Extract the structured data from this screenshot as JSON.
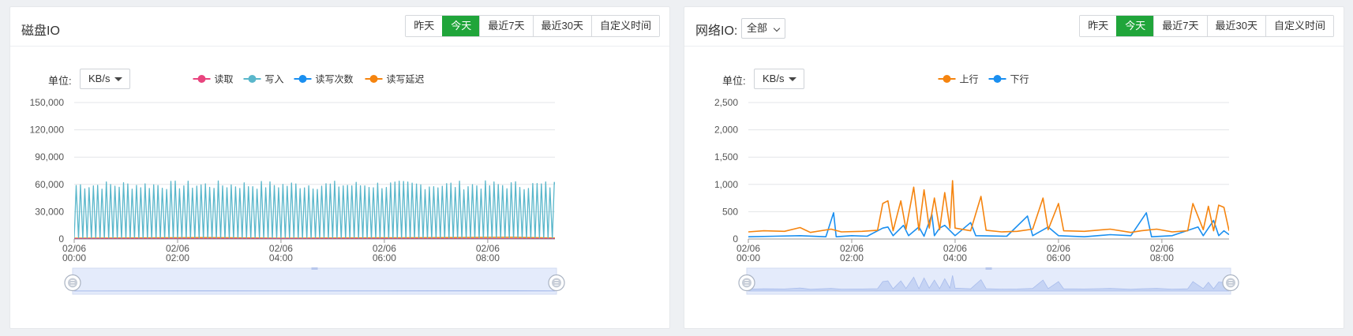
{
  "disk": {
    "title": "磁盘IO",
    "tabs": [
      {
        "label": "昨天",
        "active": false
      },
      {
        "label": "今天",
        "active": true
      },
      {
        "label": "最近7天",
        "active": false
      },
      {
        "label": "最近30天",
        "active": false
      },
      {
        "label": "自定义时间",
        "active": false
      }
    ],
    "unit_label": "单位:",
    "unit_value": "KB/s"
  },
  "net": {
    "title": "网络IO:",
    "filter_value": "全部",
    "tabs": [
      {
        "label": "昨天",
        "active": false
      },
      {
        "label": "今天",
        "active": true
      },
      {
        "label": "最近7天",
        "active": false
      },
      {
        "label": "最近30天",
        "active": false
      },
      {
        "label": "自定义时间",
        "active": false
      }
    ],
    "unit_label": "单位:",
    "unit_value": "KB/s"
  },
  "colors": {
    "accent": "#20a53a",
    "read": "#e8447e",
    "write": "#5ab7cb",
    "count": "#1a8ff0",
    "latency": "#f5840f",
    "up": "#f5840f",
    "down": "#1a8ff0"
  },
  "chart_data": [
    {
      "type": "line",
      "title": "",
      "ylabel": "",
      "ylim": [
        0,
        150000
      ],
      "yticks": [
        "0",
        "30,000",
        "60,000",
        "90,000",
        "120,000",
        "150,000"
      ],
      "xticks": [
        [
          "02/06",
          "00:00"
        ],
        [
          "02/06",
          "02:00"
        ],
        [
          "02/06",
          "04:00"
        ],
        [
          "02/06",
          "06:00"
        ],
        [
          "02/06",
          "08:00"
        ]
      ],
      "xrange_hours": [
        0,
        9.3
      ],
      "legend_position": "top",
      "series": [
        {
          "name": "读取",
          "color": "#e8447e",
          "values": [
            [
              0,
              0
            ],
            [
              9.3,
              0
            ]
          ]
        },
        {
          "name": "写入",
          "color": "#5ab7cb",
          "pattern": "oscillating",
          "peak_range": [
            54000,
            64000
          ],
          "trough": 0,
          "period_min": 5,
          "values": [
            [
              0,
              0
            ],
            [
              0.05,
              58000
            ],
            [
              0.1,
              0
            ],
            [
              0.6,
              61000
            ],
            [
              1.2,
              0
            ],
            [
              2.0,
              63000
            ],
            [
              3.0,
              60000
            ],
            [
              4.0,
              62000
            ],
            [
              5.0,
              59000
            ],
            [
              6.0,
              64000
            ],
            [
              7.0,
              60000
            ],
            [
              8.0,
              61000
            ],
            [
              9.0,
              59000
            ],
            [
              9.3,
              60000
            ]
          ]
        },
        {
          "name": "读写次数",
          "color": "#1a8ff0",
          "values": [
            [
              0,
              200
            ],
            [
              9.3,
              200
            ]
          ]
        },
        {
          "name": "读写延迟",
          "color": "#f5840f",
          "values": [
            [
              0,
              800
            ],
            [
              2.6,
              1500
            ],
            [
              4,
              900
            ],
            [
              6,
              1200
            ],
            [
              8.5,
              1800
            ],
            [
              9.3,
              1000
            ]
          ]
        }
      ]
    },
    {
      "type": "line",
      "title": "",
      "ylabel": "",
      "ylim": [
        0,
        2500
      ],
      "yticks": [
        "0",
        "500",
        "1,000",
        "1,500",
        "2,000",
        "2,500"
      ],
      "xticks": [
        [
          "02/06",
          "00:00"
        ],
        [
          "02/06",
          "02:00"
        ],
        [
          "02/06",
          "04:00"
        ],
        [
          "02/06",
          "06:00"
        ],
        [
          "02/06",
          "08:00"
        ]
      ],
      "xrange_hours": [
        0,
        9.3
      ],
      "legend_position": "top",
      "series": [
        {
          "name": "上行",
          "color": "#f5840f",
          "values": [
            [
              0,
              130
            ],
            [
              0.3,
              150
            ],
            [
              0.7,
              140
            ],
            [
              1.0,
              210
            ],
            [
              1.2,
              120
            ],
            [
              1.6,
              180
            ],
            [
              1.8,
              130
            ],
            [
              2.2,
              140
            ],
            [
              2.5,
              160
            ],
            [
              2.6,
              650
            ],
            [
              2.7,
              700
            ],
            [
              2.8,
              150
            ],
            [
              2.95,
              700
            ],
            [
              3.05,
              180
            ],
            [
              3.2,
              950
            ],
            [
              3.3,
              160
            ],
            [
              3.4,
              900
            ],
            [
              3.5,
              200
            ],
            [
              3.6,
              750
            ],
            [
              3.7,
              170
            ],
            [
              3.8,
              850
            ],
            [
              3.9,
              200
            ],
            [
              3.95,
              1070
            ],
            [
              4.0,
              200
            ],
            [
              4.3,
              150
            ],
            [
              4.5,
              780
            ],
            [
              4.6,
              160
            ],
            [
              4.9,
              130
            ],
            [
              5.2,
              140
            ],
            [
              5.5,
              180
            ],
            [
              5.7,
              750
            ],
            [
              5.8,
              170
            ],
            [
              6.0,
              650
            ],
            [
              6.1,
              150
            ],
            [
              6.5,
              140
            ],
            [
              7.0,
              180
            ],
            [
              7.4,
              120
            ],
            [
              7.6,
              150
            ],
            [
              7.9,
              180
            ],
            [
              8.2,
              130
            ],
            [
              8.5,
              150
            ],
            [
              8.6,
              650
            ],
            [
              8.8,
              170
            ],
            [
              8.9,
              600
            ],
            [
              9.0,
              150
            ],
            [
              9.1,
              620
            ],
            [
              9.2,
              580
            ],
            [
              9.3,
              150
            ]
          ]
        },
        {
          "name": "下行",
          "color": "#1a8ff0",
          "values": [
            [
              0,
              40
            ],
            [
              0.5,
              50
            ],
            [
              1.0,
              60
            ],
            [
              1.5,
              40
            ],
            [
              1.65,
              480
            ],
            [
              1.7,
              40
            ],
            [
              2.0,
              60
            ],
            [
              2.3,
              50
            ],
            [
              2.6,
              200
            ],
            [
              2.7,
              220
            ],
            [
              2.8,
              60
            ],
            [
              3.0,
              250
            ],
            [
              3.1,
              60
            ],
            [
              3.3,
              220
            ],
            [
              3.4,
              50
            ],
            [
              3.55,
              450
            ],
            [
              3.6,
              60
            ],
            [
              3.7,
              200
            ],
            [
              3.8,
              250
            ],
            [
              4.0,
              60
            ],
            [
              4.3,
              300
            ],
            [
              4.4,
              60
            ],
            [
              5.0,
              50
            ],
            [
              5.4,
              420
            ],
            [
              5.5,
              60
            ],
            [
              5.8,
              220
            ],
            [
              6.0,
              60
            ],
            [
              6.5,
              40
            ],
            [
              7.0,
              80
            ],
            [
              7.4,
              60
            ],
            [
              7.7,
              480
            ],
            [
              7.8,
              40
            ],
            [
              8.2,
              60
            ],
            [
              8.7,
              220
            ],
            [
              8.8,
              60
            ],
            [
              9.0,
              340
            ],
            [
              9.1,
              60
            ],
            [
              9.2,
              150
            ],
            [
              9.3,
              80
            ]
          ]
        }
      ]
    }
  ]
}
